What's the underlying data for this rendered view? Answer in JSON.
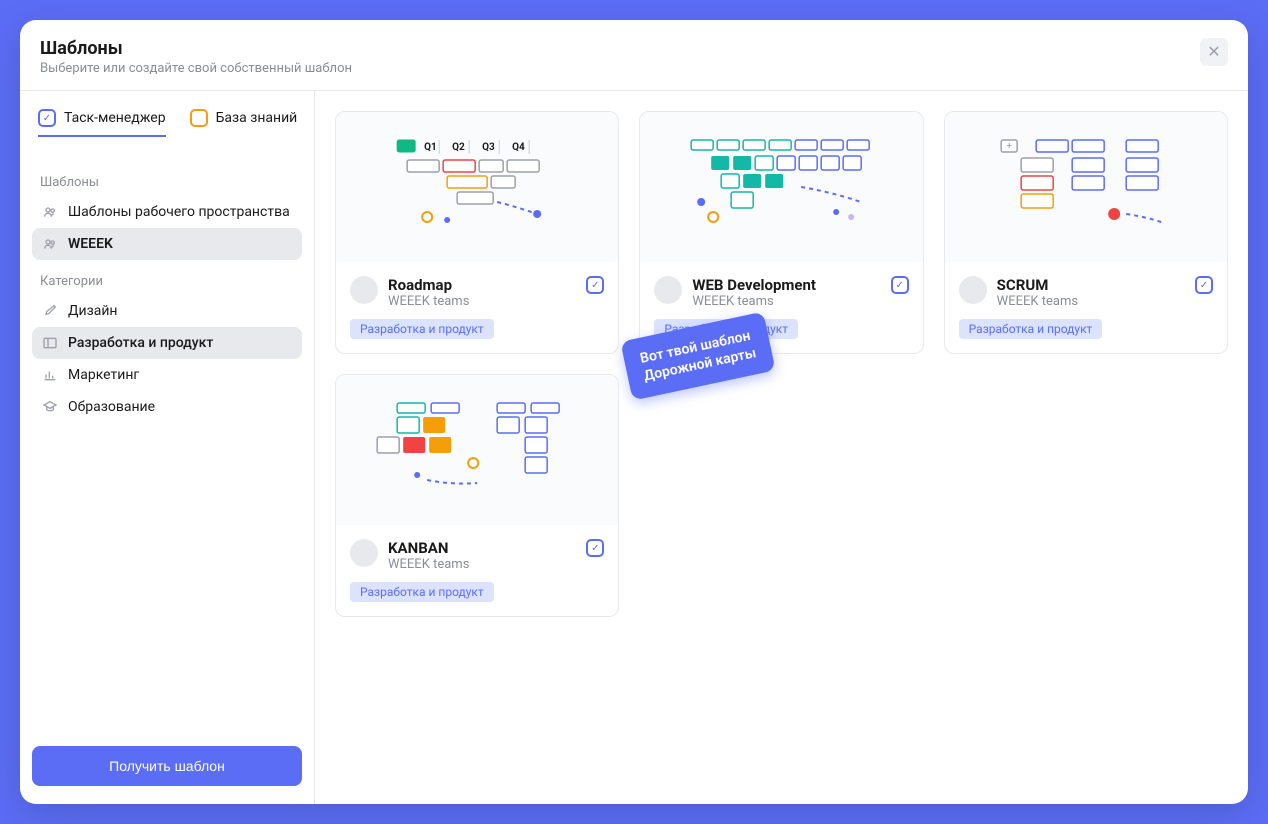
{
  "header": {
    "title": "Шаблоны",
    "subtitle": "Выберите или создайте свой собственный шаблон"
  },
  "tabs": {
    "task_manager": "Таск-менеджер",
    "knowledge_base": "База знаний"
  },
  "sidebar": {
    "templates_label": "Шаблоны",
    "categories_label": "Категории",
    "templates": [
      {
        "label": "Шаблоны рабочего пространства"
      },
      {
        "label": "WEEEK"
      }
    ],
    "categories": [
      {
        "label": "Дизайн"
      },
      {
        "label": "Разработка и продукт"
      },
      {
        "label": "Маркетинг"
      },
      {
        "label": "Образование"
      }
    ]
  },
  "cta": {
    "label": "Получить шаблон"
  },
  "cards": [
    {
      "title": "Roadmap",
      "author": "WEEEK teams",
      "tag": "Разработка и продукт",
      "preview": "roadmap",
      "quarters": {
        "q1": "Q1",
        "q2": "Q2",
        "q3": "Q3",
        "q4": "Q4"
      }
    },
    {
      "title": "WEB Development",
      "author": "WEEEK teams",
      "tag": "Разработка и продукт",
      "preview": "web"
    },
    {
      "title": "SCRUM",
      "author": "WEEEK teams",
      "tag": "Разработка и продукт",
      "preview": "scrum"
    },
    {
      "title": "KANBAN",
      "author": "WEEEK teams",
      "tag": "Разработка и продукт",
      "preview": "kanban"
    }
  ],
  "tooltip": {
    "line1": "Вот твой шаблон",
    "line2": "Дорожной карты"
  }
}
